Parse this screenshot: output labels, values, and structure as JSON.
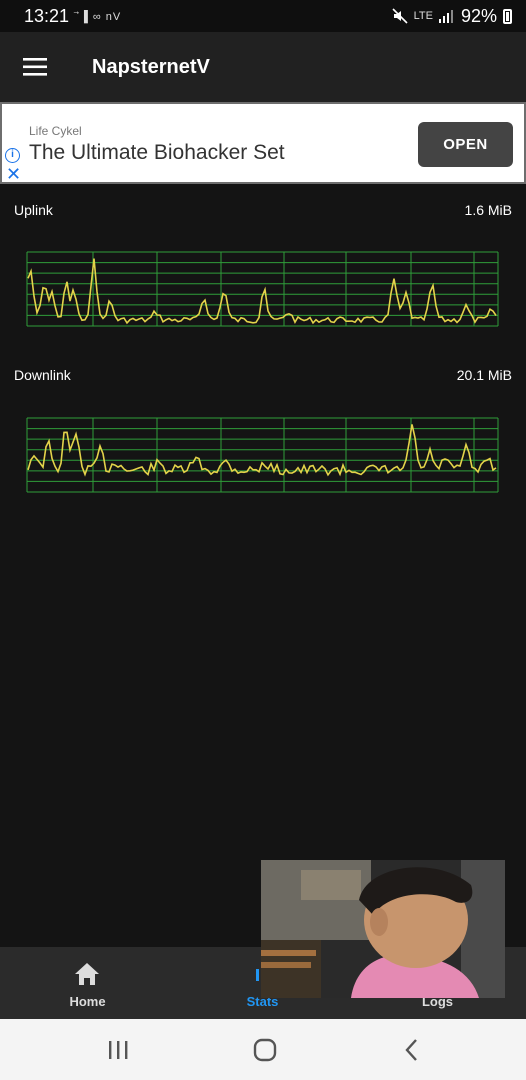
{
  "status_bar": {
    "time": "13:21",
    "left_icons": "⃗▐ ∞ nV",
    "network": "LTE",
    "battery": "92%"
  },
  "app_bar": {
    "title": "NapsternetV",
    "menu_icon": "hamburger-menu-icon"
  },
  "ad": {
    "advertiser": "Life Cykel",
    "headline": "The Ultimate Biohacker Set",
    "cta": "OPEN",
    "info_icon": "info-icon",
    "close_icon": "close-icon"
  },
  "stats": {
    "uplink": {
      "label": "Uplink",
      "value": "1.6 MiB"
    },
    "downlink": {
      "label": "Downlink",
      "value": "20.1 MiB"
    }
  },
  "colors": {
    "graph_line": "#e3d34a",
    "graph_grid": "#2f9e3a",
    "accent": "#2196f3"
  },
  "bottom_nav": {
    "items": [
      {
        "label": "Home",
        "icon": "home-icon"
      },
      {
        "label": "Stats",
        "icon": "stats-icon"
      },
      {
        "label": "Logs",
        "icon": "logs-icon"
      }
    ],
    "active": "Stats"
  },
  "system_nav": {
    "recents_icon": "recents-icon",
    "home_icon": "home-circle-icon",
    "back_icon": "back-chevron-icon"
  }
}
